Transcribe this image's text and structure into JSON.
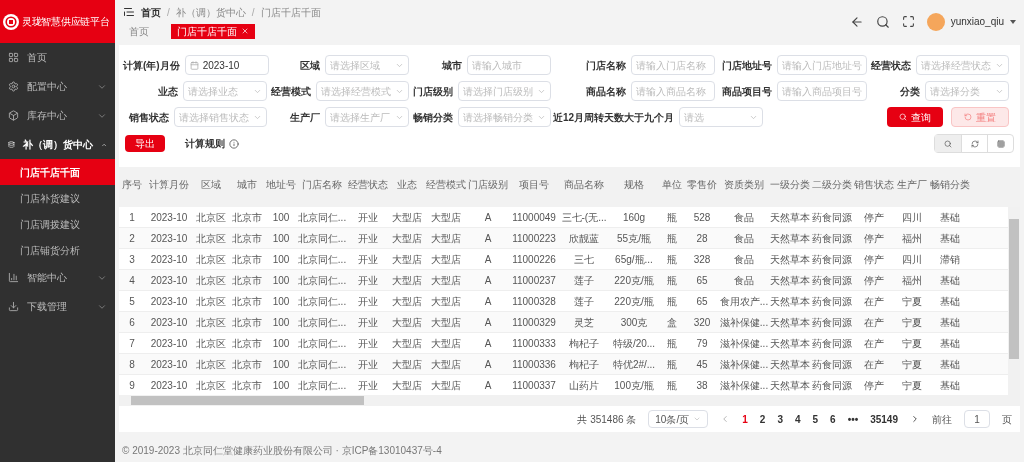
{
  "sidebar": {
    "title": "灵珑智慧供应链平台",
    "items": [
      {
        "label": "首页",
        "expandable": false,
        "expanded": false
      },
      {
        "label": "配置中心",
        "expandable": true,
        "expanded": false
      },
      {
        "label": "库存中心",
        "expandable": true,
        "expanded": false
      },
      {
        "label": "补（调）货中心",
        "expandable": true,
        "expanded": true,
        "children": [
          {
            "label": "门店千店千面",
            "selected": true
          },
          {
            "label": "门店补货建议",
            "selected": false
          },
          {
            "label": "门店调拨建议",
            "selected": false
          },
          {
            "label": "门店铺货分析",
            "selected": false
          }
        ]
      },
      {
        "label": "智能中心",
        "expandable": true,
        "expanded": false
      },
      {
        "label": "下载管理",
        "expandable": true,
        "expanded": false
      }
    ]
  },
  "header": {
    "breadcrumb": [
      "首页",
      "补（调）货中心",
      "门店千店千面"
    ],
    "separator": "/",
    "tabs": [
      {
        "label": "首页",
        "selected": false,
        "closable": false
      },
      {
        "label": "门店千店千面",
        "selected": true,
        "closable": true
      }
    ],
    "user": "yunxiao_qiu"
  },
  "filters": [
    {
      "label": "计算(年)月份",
      "kind": "date",
      "value": "2023-10"
    },
    {
      "label": "区域",
      "kind": "select",
      "placeholder": "请选择区域"
    },
    {
      "label": "城市",
      "kind": "input",
      "placeholder": "请输入城市"
    },
    {
      "label": "门店名称",
      "kind": "input",
      "placeholder": "请输入门店名称"
    },
    {
      "label": "门店地址号",
      "kind": "input",
      "placeholder": "请输入门店地址号"
    },
    {
      "label": "经营状态",
      "kind": "select",
      "placeholder": "请选择经营状态"
    },
    {
      "label": "业态",
      "kind": "select",
      "placeholder": "请选择业态"
    },
    {
      "label": "经营模式",
      "kind": "select",
      "placeholder": "请选择经营模式"
    },
    {
      "label": "门店级别",
      "kind": "select",
      "placeholder": "请选择门店级别"
    },
    {
      "label": "商品名称",
      "kind": "input",
      "placeholder": "请输入商品名称"
    },
    {
      "label": "商品项目号",
      "kind": "input",
      "placeholder": "请输入商品项目号"
    },
    {
      "label": "分类",
      "kind": "select",
      "placeholder": "请选择分类"
    },
    {
      "label": "销售状态",
      "kind": "select",
      "placeholder": "请选择销售状态"
    },
    {
      "label": "生产厂",
      "kind": "select",
      "placeholder": "请选择生产厂"
    },
    {
      "label": "畅销分类",
      "kind": "select",
      "placeholder": "请选择畅销分类"
    },
    {
      "label": "近12月周转天数大于九个月",
      "kind": "select",
      "placeholder": "请选"
    }
  ],
  "actions": [
    {
      "label": "查询",
      "kind": "primary"
    },
    {
      "label": "重置",
      "kind": "secondary"
    }
  ],
  "toolbar": {
    "export": "导出",
    "rules": "计算规则"
  },
  "table": {
    "columns": [
      "序号",
      "计算月份",
      "区域",
      "城市",
      "地址号",
      "门店名称",
      "经营状态",
      "业态",
      "经营模式",
      "门店级别",
      "项目号",
      "商品名称",
      "规格",
      "单位",
      "零售价",
      "资质类别",
      "一级分类",
      "二级分类",
      "销售状态",
      "生产厂",
      "畅销分类"
    ],
    "rows": [
      [
        "1",
        "2023-10",
        "北京区",
        "北京市",
        "100",
        "北京同仁...",
        "开业",
        "大型店",
        "大型店",
        "A",
        "11000049",
        "三七-(无...",
        "160g",
        "瓶",
        "528",
        "食品",
        "天然草本",
        "药食同源",
        "停产",
        "四川",
        "基础"
      ],
      [
        "2",
        "2023-10",
        "北京区",
        "北京市",
        "100",
        "北京同仁...",
        "开业",
        "大型店",
        "大型店",
        "A",
        "11000223",
        "欣靓蓝",
        "55克/瓶",
        "瓶",
        "28",
        "食品",
        "天然草本",
        "药食同源",
        "停产",
        "福州",
        "基础"
      ],
      [
        "3",
        "2023-10",
        "北京区",
        "北京市",
        "100",
        "北京同仁...",
        "开业",
        "大型店",
        "大型店",
        "A",
        "11000226",
        "三七",
        "65g/瓶...",
        "瓶",
        "328",
        "食品",
        "天然草本",
        "药食同源",
        "停产",
        "四川",
        "滞销"
      ],
      [
        "4",
        "2023-10",
        "北京区",
        "北京市",
        "100",
        "北京同仁...",
        "开业",
        "大型店",
        "大型店",
        "A",
        "11000237",
        "莲子",
        "220克/瓶",
        "瓶",
        "65",
        "食品",
        "天然草本",
        "药食同源",
        "停产",
        "福州",
        "基础"
      ],
      [
        "5",
        "2023-10",
        "北京区",
        "北京市",
        "100",
        "北京同仁...",
        "开业",
        "大型店",
        "大型店",
        "A",
        "11000328",
        "莲子",
        "220克/瓶",
        "瓶",
        "65",
        "食用农产...",
        "天然草本",
        "药食同源",
        "在产",
        "宁夏",
        "基础"
      ],
      [
        "6",
        "2023-10",
        "北京区",
        "北京市",
        "100",
        "北京同仁...",
        "开业",
        "大型店",
        "大型店",
        "A",
        "11000329",
        "灵芝",
        "300克",
        "盒",
        "320",
        "滋补保健...",
        "天然草本",
        "药食同源",
        "在产",
        "宁夏",
        "基础"
      ],
      [
        "7",
        "2023-10",
        "北京区",
        "北京市",
        "100",
        "北京同仁...",
        "开业",
        "大型店",
        "大型店",
        "A",
        "11000333",
        "枸杞子",
        "特级/20...",
        "瓶",
        "79",
        "滋补保健...",
        "天然草本",
        "药食同源",
        "在产",
        "宁夏",
        "基础"
      ],
      [
        "8",
        "2023-10",
        "北京区",
        "北京市",
        "100",
        "北京同仁...",
        "开业",
        "大型店",
        "大型店",
        "A",
        "11000336",
        "枸杞子",
        "特优2#/...",
        "瓶",
        "45",
        "滋补保健...",
        "天然草本",
        "药食同源",
        "在产",
        "宁夏",
        "基础"
      ],
      [
        "9",
        "2023-10",
        "北京区",
        "北京市",
        "100",
        "北京同仁...",
        "开业",
        "大型店",
        "大型店",
        "A",
        "11000337",
        "山药片",
        "100克/瓶",
        "瓶",
        "38",
        "滋补保健...",
        "天然草本",
        "药食同源",
        "停产",
        "宁夏",
        "基础"
      ]
    ]
  },
  "pagination": {
    "total": "共 351486 条",
    "page_size": "10条/页",
    "pages": [
      {
        "label": "1",
        "selected": true
      },
      {
        "label": "2",
        "selected": false
      },
      {
        "label": "3",
        "selected": false
      },
      {
        "label": "4",
        "selected": false
      },
      {
        "label": "5",
        "selected": false
      },
      {
        "label": "6",
        "selected": false
      },
      {
        "label": "•••",
        "selected": false
      },
      {
        "label": "35149",
        "selected": false
      }
    ],
    "goto_label": "前往",
    "goto_value": "1",
    "goto_suffix": "页"
  },
  "footer": "© 2019-2023 北京同仁堂健康药业股份有限公司 · 京ICP备13010437号-4"
}
